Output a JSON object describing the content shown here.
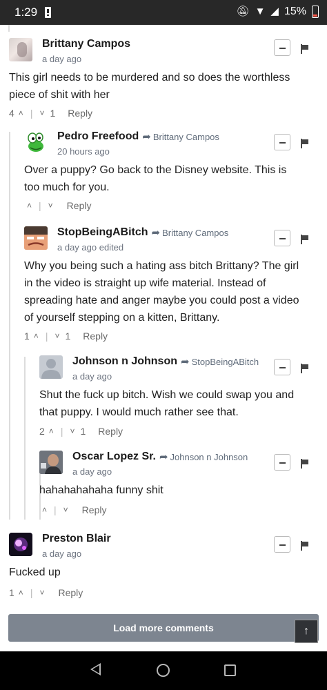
{
  "status_bar": {
    "time": "1:29",
    "battery": "15%"
  },
  "comments": [
    {
      "author": "Brittany Campos",
      "reply_to": "",
      "meta": "a day ago",
      "body": [
        "This girl needs to be murdered and so does the worthless",
        "piece of shit with her"
      ],
      "upvotes": "4",
      "downvotes": "1",
      "reply_label": "Reply"
    },
    {
      "author": "Pedro Freefood",
      "reply_to": "Brittany Campos",
      "meta": "20 hours ago",
      "body": [
        "Over a puppy? Go back to the Disney website. This is",
        "too much for you."
      ],
      "upvotes": "",
      "downvotes": "",
      "reply_label": "Reply"
    },
    {
      "author": "StopBeingABitch",
      "reply_to": "Brittany Campos",
      "meta": "a day ago edited",
      "body": [
        "Why you being such a hating ass bitch Brittany? The girl",
        "in the video is straight up wife material. Instead of",
        "spreading hate and anger maybe you could post a video",
        "of yourself stepping on a kitten, Brittany."
      ],
      "upvotes": "1",
      "downvotes": "1",
      "reply_label": "Reply"
    },
    {
      "author": "Johnson n Johnson",
      "reply_to": "StopBeingABitch",
      "meta": "a day ago",
      "body": [
        "Shut the fuck up bitch. Wish we could swap you and",
        "that puppy. I would much rather see that."
      ],
      "upvotes": "2",
      "downvotes": "1",
      "reply_label": "Reply"
    },
    {
      "author": "Oscar Lopez Sr.",
      "reply_to": "Johnson n Johnson",
      "meta": "a day ago",
      "body": [
        "hahahahahaha funny shit"
      ],
      "upvotes": "",
      "downvotes": "",
      "reply_label": "Reply"
    },
    {
      "author": "Preston Blair",
      "reply_to": "",
      "meta": "a day ago",
      "body": [
        "Fucked up"
      ],
      "upvotes": "1",
      "downvotes": "",
      "reply_label": "Reply"
    }
  ],
  "load_more_label": "Load more comments",
  "icons": {
    "collapse": "minus-square-icon",
    "flag": "flag-icon",
    "upvote": "chevron-up-icon",
    "downvote": "chevron-down-icon",
    "reply_arrow": "reply-arrow-icon",
    "scroll_top": "arrow-up-icon"
  }
}
